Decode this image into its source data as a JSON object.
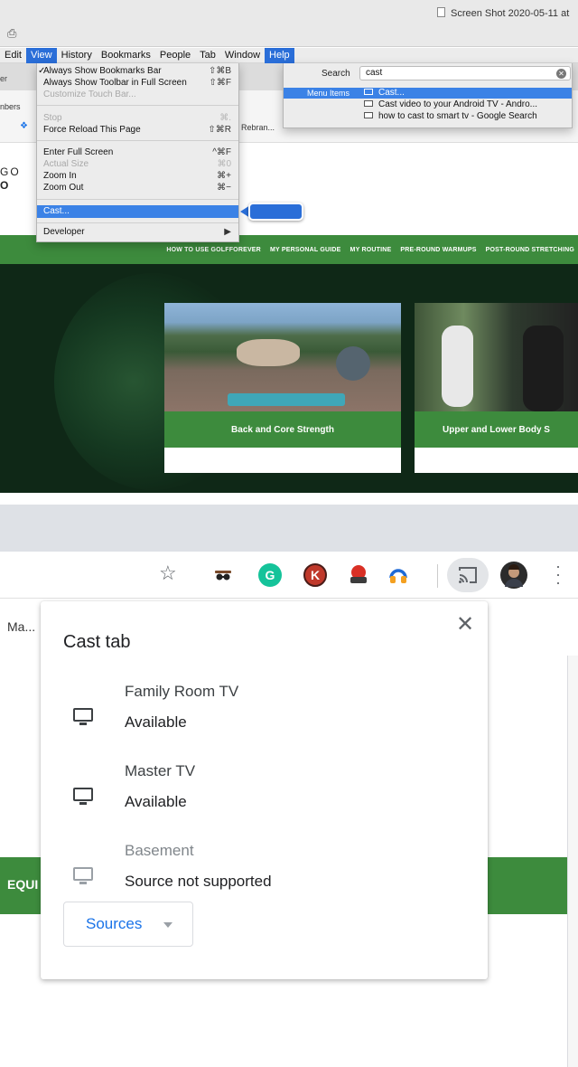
{
  "screenshot_title": "Screen Shot 2020-05-11 at",
  "menubar": {
    "items": [
      "Edit",
      "View",
      "History",
      "Bookmarks",
      "People",
      "Tab",
      "Window",
      "Help"
    ],
    "active": [
      "View",
      "Help"
    ]
  },
  "browser": {
    "tab_fragment": "er",
    "bookmark_fragment_left": "nbers",
    "bookmark_fragment_rebrand": "Rebran..."
  },
  "view_menu": {
    "items": [
      {
        "label": "Always Show Bookmarks Bar",
        "shortcut": "⇧⌘B",
        "checked": true,
        "disabled": false
      },
      {
        "label": "Always Show Toolbar in Full Screen",
        "shortcut": "⇧⌘F",
        "checked": false,
        "disabled": false
      },
      {
        "label": "Customize Touch Bar...",
        "shortcut": "",
        "checked": false,
        "disabled": true
      },
      {
        "label": "Stop",
        "shortcut": "⌘.",
        "checked": false,
        "disabled": true
      },
      {
        "label": "Force Reload This Page",
        "shortcut": "⇧⌘R",
        "checked": false,
        "disabled": false
      },
      {
        "label": "Enter Full Screen",
        "shortcut": "^⌘F",
        "checked": false,
        "disabled": false
      },
      {
        "label": "Actual Size",
        "shortcut": "⌘0",
        "checked": false,
        "disabled": true
      },
      {
        "label": "Zoom In",
        "shortcut": "⌘+",
        "checked": false,
        "disabled": false
      },
      {
        "label": "Zoom Out",
        "shortcut": "⌘−",
        "checked": false,
        "disabled": false
      },
      {
        "label": "Cast...",
        "shortcut": "",
        "checked": false,
        "disabled": false,
        "highlighted": true
      },
      {
        "label": "Developer",
        "shortcut": "▶",
        "checked": false,
        "disabled": false
      }
    ]
  },
  "help_menu": {
    "search_label": "Search",
    "search_value": "cast",
    "category_label": "Menu Items",
    "results": [
      {
        "label": "Cast...",
        "highlighted": true
      },
      {
        "label": "Cast video to your Android TV - Andro...",
        "highlighted": false
      },
      {
        "label": "how to cast to smart tv - Google Search",
        "highlighted": false
      }
    ]
  },
  "site": {
    "logo_top": "GO",
    "logo_bottom": "O",
    "nav": [
      "HOW TO USE GOLFFOREVER",
      "MY PERSONAL GUIDE",
      "MY ROUTINE",
      "PRE-ROUND WARMUPS",
      "POST-ROUND STRETCHING"
    ],
    "cards": [
      "Back and Core Strength",
      "Upper and Lower Body S"
    ]
  },
  "chrome": {
    "extension_letters": {
      "grammarly": "G",
      "k": "K"
    },
    "bookmark_fragment": "Ma...",
    "page_fragment": "EQUI"
  },
  "cast_dialog": {
    "title": "Cast tab",
    "close_glyph": "✕",
    "sinks": [
      {
        "name": "Family Room TV",
        "status": "Available",
        "disabled": false
      },
      {
        "name": "Master TV",
        "status": "Available",
        "disabled": false
      },
      {
        "name": "Basement",
        "status": "Source not supported",
        "disabled": true
      }
    ],
    "sources_label": "Sources"
  },
  "colors": {
    "mac_highlight": "#3b82e6",
    "site_green": "#3d8b3d",
    "chrome_blue": "#1a73e8"
  }
}
